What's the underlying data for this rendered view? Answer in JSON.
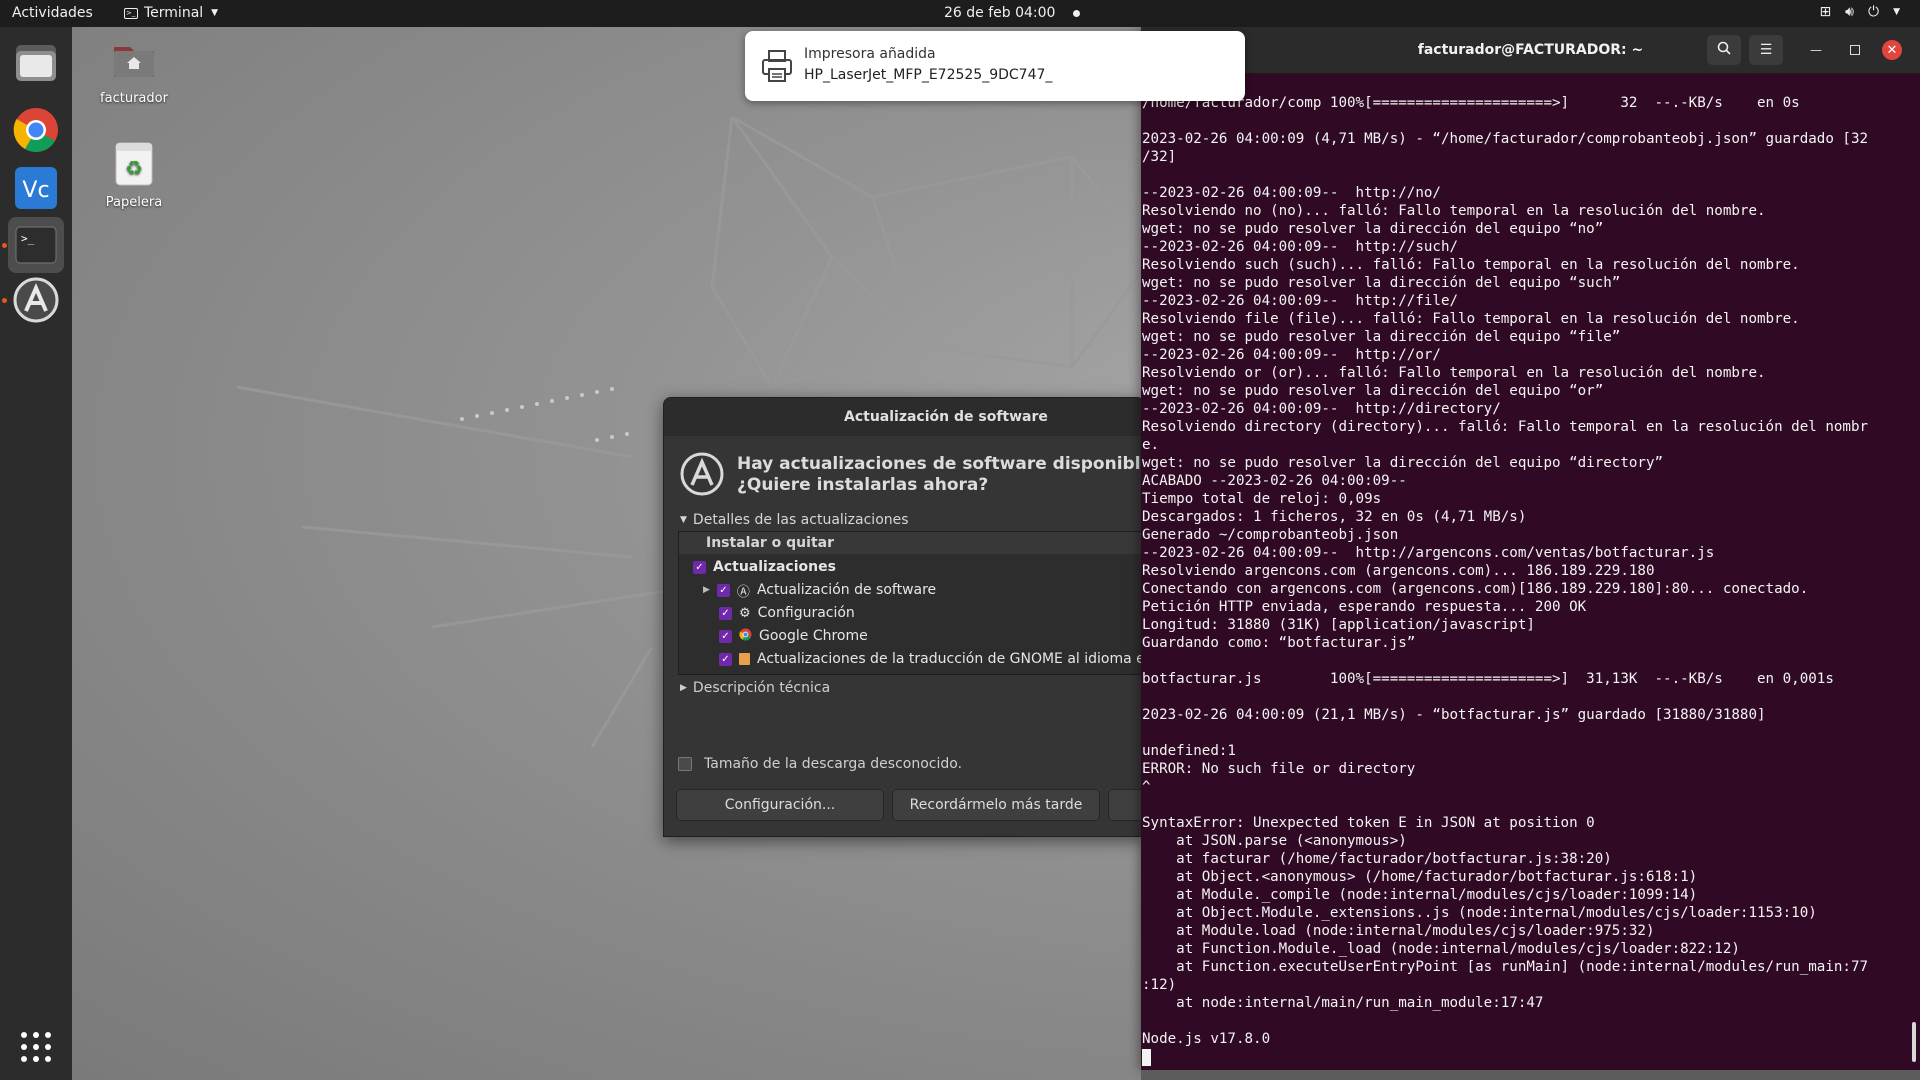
{
  "topbar": {
    "activities": "Actividades",
    "app_name": "Terminal",
    "clock": "26 de feb  04:00"
  },
  "dock": {
    "items": [
      "files-icon",
      "chrome-icon",
      "vscode-icon",
      "terminal-icon",
      "software-updater-icon"
    ],
    "apps_grid": "show-apps-icon"
  },
  "desktop": {
    "home_label": "facturador",
    "trash_label": "Papelera"
  },
  "notification": {
    "title": "Impresora añadida",
    "body": "HP_LaserJet_MFP_E72525_9DC747_"
  },
  "updater": {
    "window_title": "Actualización de software",
    "heading_line1": "Hay actualizaciones de software disponibles par",
    "heading_line2": "¿Quiere instalarlas ahora?",
    "details_toggle": "Detalles de las actualizaciones",
    "column_header": "Instalar o quitar",
    "group_label": "Actualizaciones",
    "items": [
      "Actualización de software",
      "Configuración",
      "Google Chrome",
      "Actualizaciones de la traducción de GNOME al idioma esp"
    ],
    "tech_desc": "Descripción técnica",
    "download_size": "Tamaño de la descarga desconocido.",
    "btn_settings": "Configuración...",
    "btn_later": "Recordármelo más tarde"
  },
  "terminal": {
    "title": "facturador@FACTURADOR: ~",
    "lines": [
      "/home/facturador/comp 100%[=====================>]      32  --.-KB/s    en 0s",
      "",
      "2023-02-26 04:00:09 (4,71 MB/s) - “/home/facturador/comprobanteobj.json” guardado [32",
      "/32]",
      "",
      "--2023-02-26 04:00:09--  http://no/",
      "Resolviendo no (no)... falló: Fallo temporal en la resolución del nombre.",
      "wget: no se pudo resolver la dirección del equipo “no”",
      "--2023-02-26 04:00:09--  http://such/",
      "Resolviendo such (such)... falló: Fallo temporal en la resolución del nombre.",
      "wget: no se pudo resolver la dirección del equipo “such”",
      "--2023-02-26 04:00:09--  http://file/",
      "Resolviendo file (file)... falló: Fallo temporal en la resolución del nombre.",
      "wget: no se pudo resolver la dirección del equipo “file”",
      "--2023-02-26 04:00:09--  http://or/",
      "Resolviendo or (or)... falló: Fallo temporal en la resolución del nombre.",
      "wget: no se pudo resolver la dirección del equipo “or”",
      "--2023-02-26 04:00:09--  http://directory/",
      "Resolviendo directory (directory)... falló: Fallo temporal en la resolución del nombr",
      "e.",
      "wget: no se pudo resolver la dirección del equipo “directory”",
      "ACABADO --2023-02-26 04:00:09--",
      "Tiempo total de reloj: 0,09s",
      "Descargados: 1 ficheros, 32 en 0s (4,71 MB/s)",
      "Generado ~/comprobanteobj.json",
      "--2023-02-26 04:00:09--  http://argencons.com/ventas/botfacturar.js",
      "Resolviendo argencons.com (argencons.com)... 186.189.229.180",
      "Conectando con argencons.com (argencons.com)[186.189.229.180]:80... conectado.",
      "Petición HTTP enviada, esperando respuesta... 200 OK",
      "Longitud: 31880 (31K) [application/javascript]",
      "Guardando como: “botfacturar.js”",
      "",
      "botfacturar.js        100%[=====================>]  31,13K  --.-KB/s    en 0,001s",
      "",
      "2023-02-26 04:00:09 (21,1 MB/s) - “botfacturar.js” guardado [31880/31880]",
      "",
      "undefined:1",
      "ERROR: No such file or directory",
      "^",
      "",
      "SyntaxError: Unexpected token E in JSON at position 0",
      "    at JSON.parse (<anonymous>)",
      "    at facturar (/home/facturador/botfacturar.js:38:20)",
      "    at Object.<anonymous> (/home/facturador/botfacturar.js:618:1)",
      "    at Module._compile (node:internal/modules/cjs/loader:1099:14)",
      "    at Object.Module._extensions..js (node:internal/modules/cjs/loader:1153:10)",
      "    at Module.load (node:internal/modules/cjs/loader:975:32)",
      "    at Function.Module._load (node:internal/modules/cjs/loader:822:12)",
      "    at Function.executeUserEntryPoint [as runMain] (node:internal/modules/run_main:77",
      ":12)",
      "    at node:internal/main/run_main_module:17:47",
      "",
      "Node.js v17.8.0"
    ]
  }
}
